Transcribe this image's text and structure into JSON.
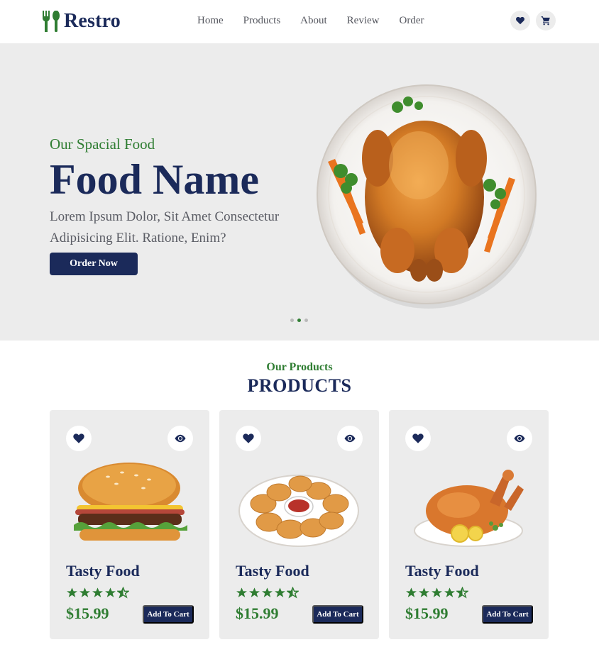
{
  "brand": {
    "name": "Restro",
    "icon": "fork-spoon-icon"
  },
  "nav": {
    "items": [
      {
        "label": "Home"
      },
      {
        "label": "Products"
      },
      {
        "label": "About"
      },
      {
        "label": "Review"
      },
      {
        "label": "Order"
      }
    ]
  },
  "header_icons": {
    "wishlist": "heart-icon",
    "cart": "cart-icon"
  },
  "hero": {
    "subtitle": "Our Spacial Food",
    "title": "Food Name",
    "description": "Lorem Ipsum Dolor, Sit Amet Consectetur Adipisicing Elit. Ratione, Enim?",
    "button_label": "Order Now",
    "image": "roast-chicken-plate",
    "slides_count": 3,
    "active_slide": 2
  },
  "products_section": {
    "subtitle": "Our Products",
    "title": "PRODUCTS",
    "items": [
      {
        "name": "Tasty Food",
        "price": "$15.99",
        "rating": 4.5,
        "image": "burger",
        "button": "Add To Cart"
      },
      {
        "name": "Tasty Food",
        "price": "$15.99",
        "rating": 4.5,
        "image": "chicken-nuggets",
        "button": "Add To Cart"
      },
      {
        "name": "Tasty Food",
        "price": "$15.99",
        "rating": 4.5,
        "image": "roast-chicken",
        "button": "Add To Cart"
      }
    ]
  },
  "colors": {
    "primary": "#1b2a5a",
    "accent": "#2f7d32",
    "surface": "#ececec",
    "text_muted": "#5a5c64"
  }
}
